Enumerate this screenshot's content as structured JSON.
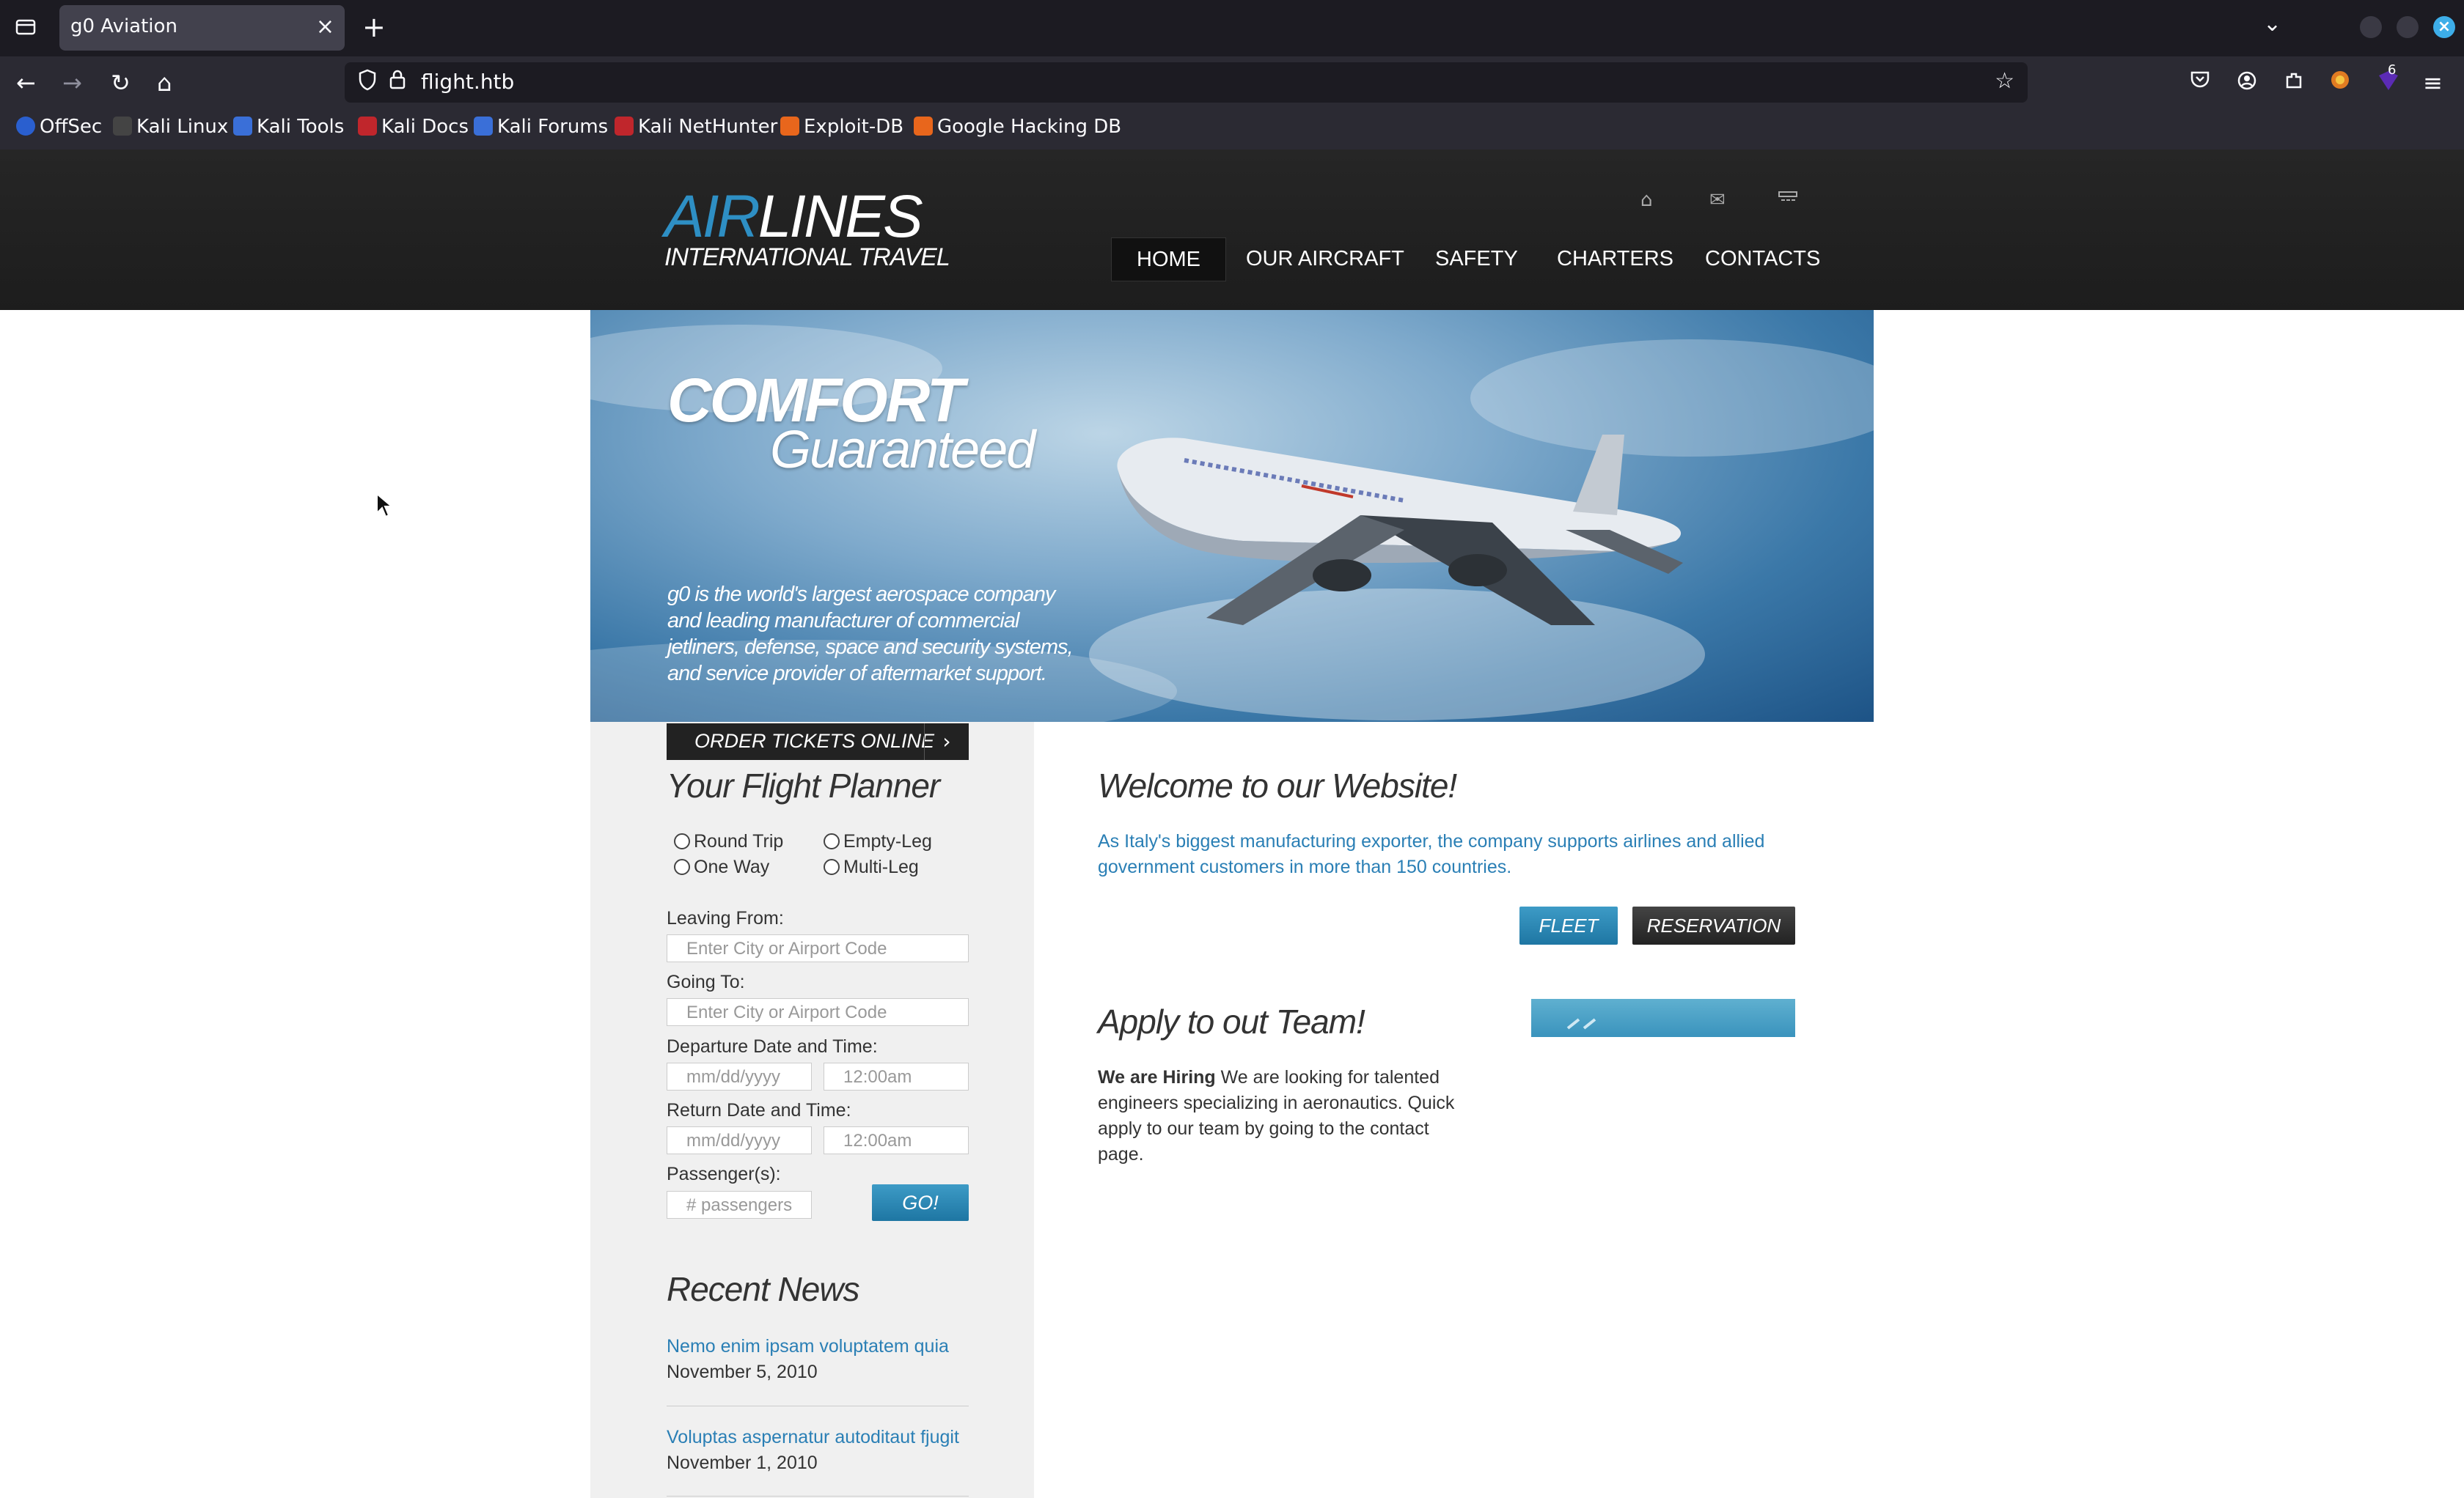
{
  "browser": {
    "tab_title": "g0 Aviation",
    "url": "flight.htb",
    "bookmarks": [
      "OffSec",
      "Kali Linux",
      "Kali Tools",
      "Kali Docs",
      "Kali Forums",
      "Kali NetHunter",
      "Exploit-DB",
      "Google Hacking DB"
    ],
    "extension_badge": "6"
  },
  "site": {
    "logo_air": "AIR",
    "logo_lines": "LINES",
    "logo_sub": "INTERNATIONAL TRAVEL",
    "menu": [
      "HOME",
      "OUR AIRCRAFT",
      "SAFETY",
      "CHARTERS",
      "CONTACTS"
    ],
    "active_menu": "HOME"
  },
  "banner": {
    "title": "COMFORT",
    "subtitle": "Guaranteed",
    "text": "g0 is the world's largest aerospace company and leading manufacturer of commercial jetliners, defense, space and security systems, and service provider of aftermarket support."
  },
  "planner": {
    "order_button": "ORDER TICKETS ONLINE",
    "heading": "Your Flight Planner",
    "radios": [
      "Round Trip",
      "Empty-Leg",
      "One Way",
      "Multi-Leg"
    ],
    "leaving_label": "Leaving From:",
    "leaving_placeholder": "Enter City or Airport Code",
    "going_label": "Going To:",
    "going_placeholder": "Enter City or Airport Code",
    "departure_label": "Departure Date and Time:",
    "return_label": "Return Date and Time:",
    "date_placeholder": "mm/dd/yyyy",
    "time_placeholder": "12:00am",
    "passengers_label": "Passenger(s):",
    "passengers_placeholder": "# passengers",
    "go_button": "GO!"
  },
  "news": {
    "heading": "Recent News",
    "items": [
      {
        "title": "Nemo enim ipsam voluptatem quia",
        "date": "November 5, 2010"
      },
      {
        "title": "Voluptas aspernatur autoditaut fjugit",
        "date": "November 1, 2010"
      }
    ]
  },
  "main": {
    "welcome_heading": "Welcome to our Website!",
    "welcome_text": "As Italy's biggest manufacturing exporter, the company supports airlines and allied government customers in more than 150 countries.",
    "fleet_button": "FLEET",
    "reservation_button": "RESERVATION",
    "apply_heading": "Apply to out Team!",
    "hiring_bold": "We are Hiring",
    "hiring_text": " We are looking for talented engineers specializing in aeronautics. Quick apply to our team by going to the contact page."
  },
  "colors": {
    "accent_blue": "#2a7fb5",
    "header_bg": "#1d1d1d",
    "sidebar_bg": "#f0f0f0"
  }
}
